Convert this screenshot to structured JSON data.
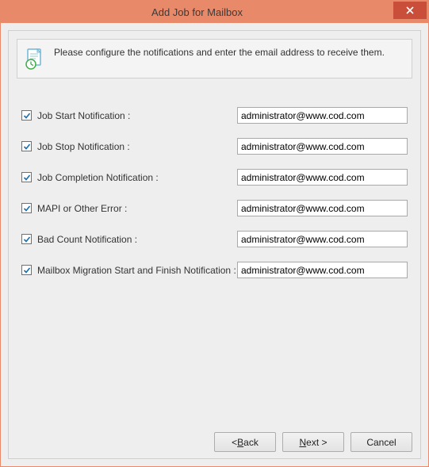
{
  "window": {
    "title": "Add Job for Mailbox"
  },
  "info": {
    "text": "Please configure the notifications and enter the email address to receive them."
  },
  "rows": [
    {
      "label": "Job Start Notification :",
      "value": "administrator@www.cod.com"
    },
    {
      "label": "Job Stop Notification :",
      "value": "administrator@www.cod.com"
    },
    {
      "label": "Job Completion Notification :",
      "value": "administrator@www.cod.com"
    },
    {
      "label": "MAPI or Other Error :",
      "value": "administrator@www.cod.com"
    },
    {
      "label": "Bad Count Notification :",
      "value": "administrator@www.cod.com"
    },
    {
      "label": "Mailbox Migration Start and Finish Notification :",
      "value": "administrator@www.cod.com"
    }
  ],
  "buttons": {
    "back_prefix": "< ",
    "back_u": "B",
    "back_suffix": "ack",
    "next_u": "N",
    "next_suffix": "ext >",
    "cancel": "Cancel"
  }
}
